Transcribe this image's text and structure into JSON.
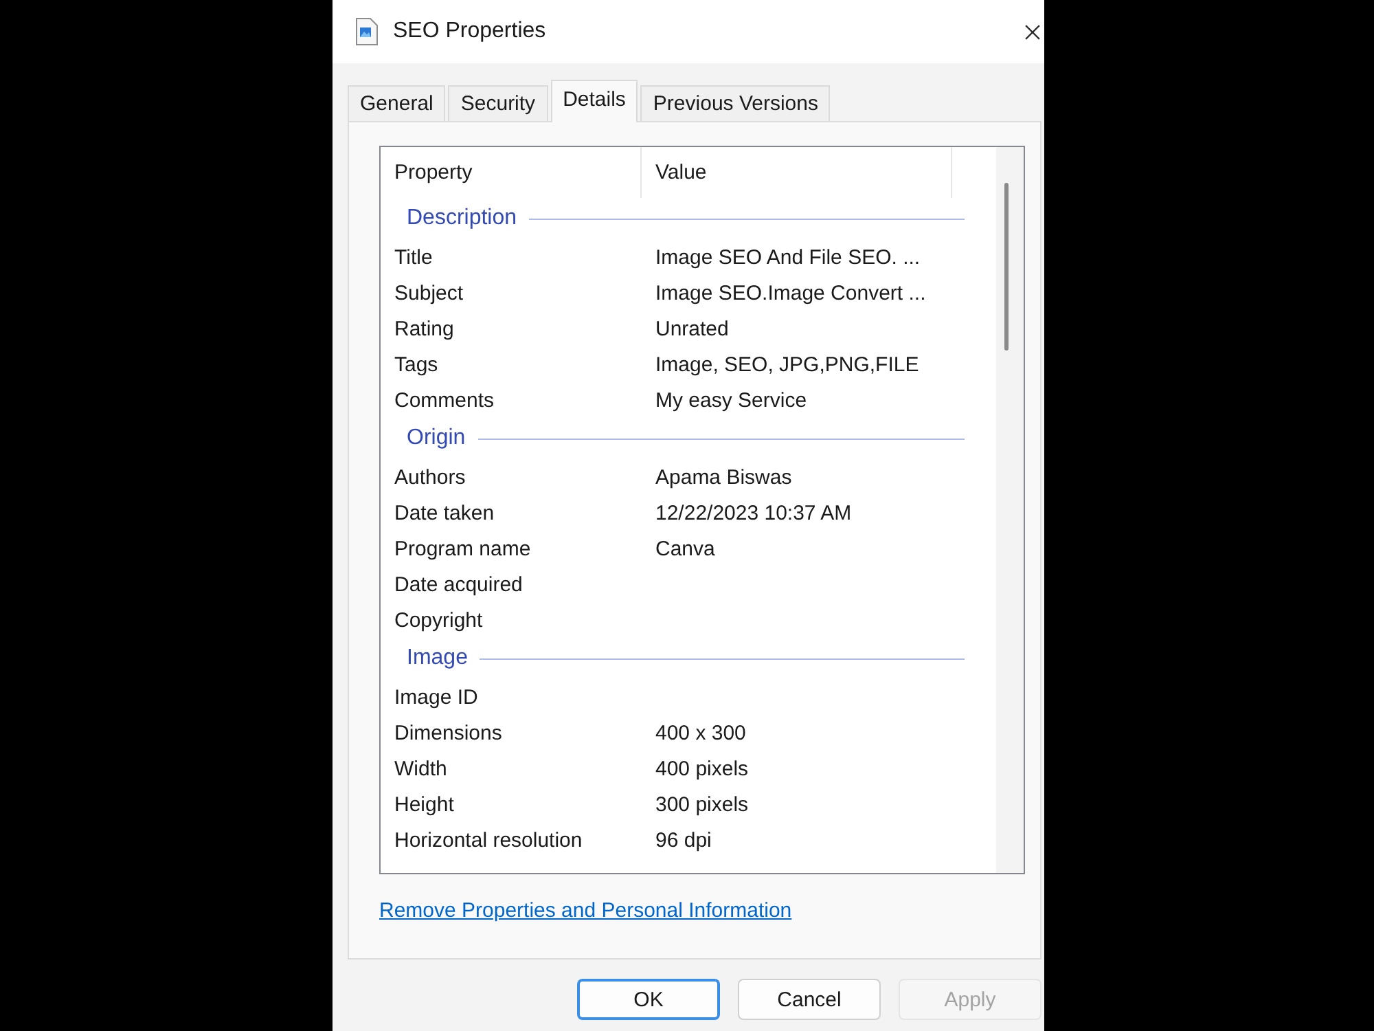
{
  "window": {
    "title": "SEO Properties"
  },
  "tabs": [
    {
      "label": "General",
      "selected": false
    },
    {
      "label": "Security",
      "selected": false
    },
    {
      "label": "Details",
      "selected": true
    },
    {
      "label": "Previous Versions",
      "selected": false
    }
  ],
  "details": {
    "columns": [
      "Property",
      "Value"
    ],
    "groups": [
      {
        "name": "Description",
        "rows": [
          {
            "property": "Title",
            "value": "Image SEO And File SEO. ..."
          },
          {
            "property": "Subject",
            "value": "Image SEO.Image Convert ..."
          },
          {
            "property": "Rating",
            "value": "Unrated"
          },
          {
            "property": "Tags",
            "value": "Image, SEO, JPG,PNG,FILE"
          },
          {
            "property": "Comments",
            "value": "My easy Service"
          }
        ]
      },
      {
        "name": "Origin",
        "rows": [
          {
            "property": "Authors",
            "value": "Apama Biswas"
          },
          {
            "property": "Date taken",
            "value": "12/22/2023 10:37 AM"
          },
          {
            "property": "Program name",
            "value": "Canva"
          },
          {
            "property": "Date acquired"
          },
          {
            "property": "Copyright"
          }
        ]
      },
      {
        "name": "Image",
        "rows": [
          {
            "property": "Image ID"
          },
          {
            "property": "Dimensions",
            "value": "400 x 300"
          },
          {
            "property": "Width",
            "value": "400 pixels"
          },
          {
            "property": "Height",
            "value": "300 pixels"
          },
          {
            "property": "Horizontal resolution",
            "value": "96 dpi"
          }
        ]
      }
    ]
  },
  "link": "Remove Properties and Personal Information",
  "buttons": [
    {
      "label": "OK",
      "default": true,
      "disabled": false
    },
    {
      "label": "Cancel",
      "default": false,
      "disabled": false
    },
    {
      "label": "Apply",
      "default": false,
      "disabled": true
    }
  ]
}
